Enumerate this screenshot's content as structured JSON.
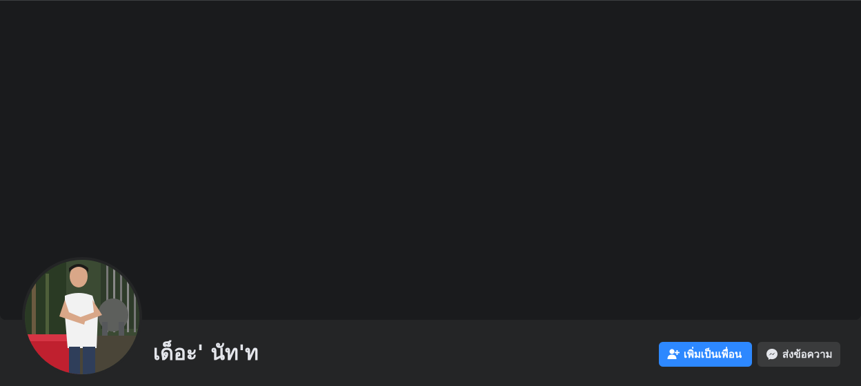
{
  "profile": {
    "name": "เด็อะ' นัท'ท",
    "avatar_alt": "profile photo"
  },
  "actions": {
    "add_friend_label": "เพิ่มเป็นเพื่อน",
    "add_friend_icon": "add-friend-icon",
    "message_label": "ส่งข้อความ",
    "message_icon": "messenger-icon"
  },
  "colors": {
    "primary": "#2d88ff",
    "secondary_button": "#3a3b3c",
    "cover": "#1a1b1d",
    "background": "#242526",
    "text": "#e4e6eb"
  }
}
